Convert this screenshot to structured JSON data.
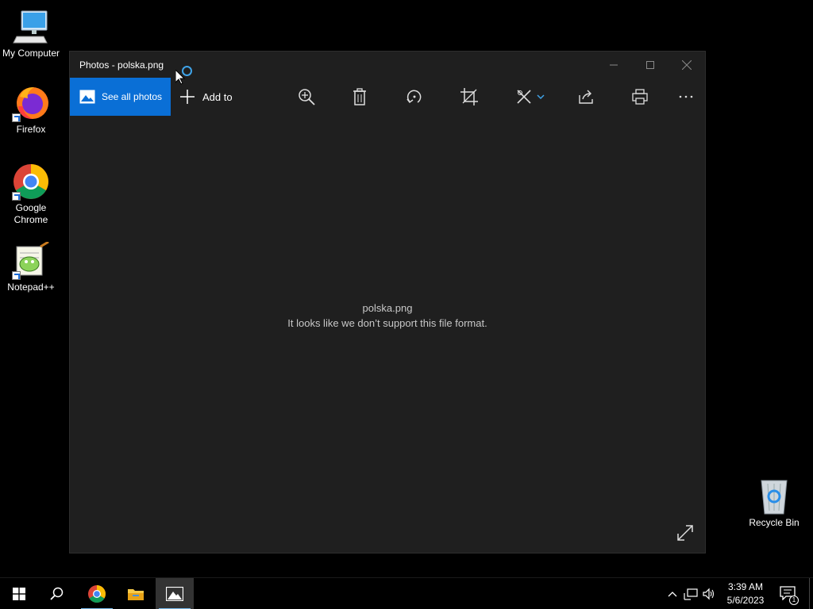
{
  "desktop": {
    "icons": [
      {
        "label": "My Computer"
      },
      {
        "label": "Firefox"
      },
      {
        "label": "Google Chrome"
      },
      {
        "label": "Notepad++"
      },
      {
        "label": "Recycle Bin"
      }
    ]
  },
  "window": {
    "title": "Photos - polska.png",
    "toolbar": {
      "see_all_label": "See all photos",
      "add_to_label": "Add to"
    },
    "message": {
      "filename": "polska.png",
      "error": "It looks like we don’t support this file format."
    }
  },
  "taskbar": {
    "time": "3:39 AM",
    "date": "5/6/2023",
    "notification_count": "1"
  },
  "colors": {
    "accent": "#0a6fd6",
    "window_bg": "#1f1f1f",
    "taskbar_bg": "#000000"
  }
}
